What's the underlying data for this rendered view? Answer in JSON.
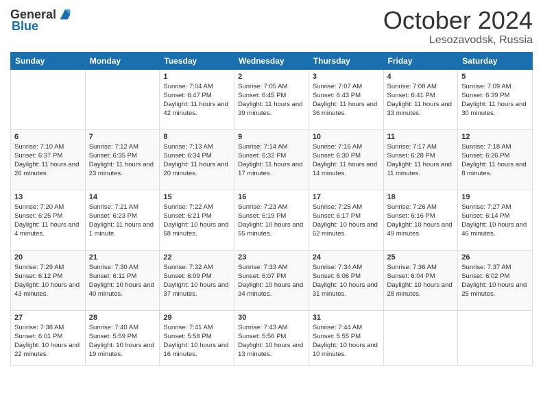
{
  "header": {
    "logo_general": "General",
    "logo_blue": "Blue",
    "month": "October 2024",
    "location": "Lesozavodsk, Russia"
  },
  "days_of_week": [
    "Sunday",
    "Monday",
    "Tuesday",
    "Wednesday",
    "Thursday",
    "Friday",
    "Saturday"
  ],
  "weeks": [
    [
      {
        "day": "",
        "info": ""
      },
      {
        "day": "",
        "info": ""
      },
      {
        "day": "1",
        "info": "Sunrise: 7:04 AM\nSunset: 6:47 PM\nDaylight: 11 hours and 42 minutes."
      },
      {
        "day": "2",
        "info": "Sunrise: 7:05 AM\nSunset: 6:45 PM\nDaylight: 11 hours and 39 minutes."
      },
      {
        "day": "3",
        "info": "Sunrise: 7:07 AM\nSunset: 6:43 PM\nDaylight: 11 hours and 36 minutes."
      },
      {
        "day": "4",
        "info": "Sunrise: 7:08 AM\nSunset: 6:41 PM\nDaylight: 11 hours and 33 minutes."
      },
      {
        "day": "5",
        "info": "Sunrise: 7:09 AM\nSunset: 6:39 PM\nDaylight: 11 hours and 30 minutes."
      }
    ],
    [
      {
        "day": "6",
        "info": "Sunrise: 7:10 AM\nSunset: 6:37 PM\nDaylight: 11 hours and 26 minutes."
      },
      {
        "day": "7",
        "info": "Sunrise: 7:12 AM\nSunset: 6:35 PM\nDaylight: 11 hours and 23 minutes."
      },
      {
        "day": "8",
        "info": "Sunrise: 7:13 AM\nSunset: 6:34 PM\nDaylight: 11 hours and 20 minutes."
      },
      {
        "day": "9",
        "info": "Sunrise: 7:14 AM\nSunset: 6:32 PM\nDaylight: 11 hours and 17 minutes."
      },
      {
        "day": "10",
        "info": "Sunrise: 7:16 AM\nSunset: 6:30 PM\nDaylight: 11 hours and 14 minutes."
      },
      {
        "day": "11",
        "info": "Sunrise: 7:17 AM\nSunset: 6:28 PM\nDaylight: 11 hours and 11 minutes."
      },
      {
        "day": "12",
        "info": "Sunrise: 7:18 AM\nSunset: 6:26 PM\nDaylight: 11 hours and 8 minutes."
      }
    ],
    [
      {
        "day": "13",
        "info": "Sunrise: 7:20 AM\nSunset: 6:25 PM\nDaylight: 11 hours and 4 minutes."
      },
      {
        "day": "14",
        "info": "Sunrise: 7:21 AM\nSunset: 6:23 PM\nDaylight: 11 hours and 1 minute."
      },
      {
        "day": "15",
        "info": "Sunrise: 7:22 AM\nSunset: 6:21 PM\nDaylight: 10 hours and 58 minutes."
      },
      {
        "day": "16",
        "info": "Sunrise: 7:23 AM\nSunset: 6:19 PM\nDaylight: 10 hours and 55 minutes."
      },
      {
        "day": "17",
        "info": "Sunrise: 7:25 AM\nSunset: 6:17 PM\nDaylight: 10 hours and 52 minutes."
      },
      {
        "day": "18",
        "info": "Sunrise: 7:26 AM\nSunset: 6:16 PM\nDaylight: 10 hours and 49 minutes."
      },
      {
        "day": "19",
        "info": "Sunrise: 7:27 AM\nSunset: 6:14 PM\nDaylight: 10 hours and 46 minutes."
      }
    ],
    [
      {
        "day": "20",
        "info": "Sunrise: 7:29 AM\nSunset: 6:12 PM\nDaylight: 10 hours and 43 minutes."
      },
      {
        "day": "21",
        "info": "Sunrise: 7:30 AM\nSunset: 6:11 PM\nDaylight: 10 hours and 40 minutes."
      },
      {
        "day": "22",
        "info": "Sunrise: 7:32 AM\nSunset: 6:09 PM\nDaylight: 10 hours and 37 minutes."
      },
      {
        "day": "23",
        "info": "Sunrise: 7:33 AM\nSunset: 6:07 PM\nDaylight: 10 hours and 34 minutes."
      },
      {
        "day": "24",
        "info": "Sunrise: 7:34 AM\nSunset: 6:06 PM\nDaylight: 10 hours and 31 minutes."
      },
      {
        "day": "25",
        "info": "Sunrise: 7:36 AM\nSunset: 6:04 PM\nDaylight: 10 hours and 28 minutes."
      },
      {
        "day": "26",
        "info": "Sunrise: 7:37 AM\nSunset: 6:02 PM\nDaylight: 10 hours and 25 minutes."
      }
    ],
    [
      {
        "day": "27",
        "info": "Sunrise: 7:38 AM\nSunset: 6:01 PM\nDaylight: 10 hours and 22 minutes."
      },
      {
        "day": "28",
        "info": "Sunrise: 7:40 AM\nSunset: 5:59 PM\nDaylight: 10 hours and 19 minutes."
      },
      {
        "day": "29",
        "info": "Sunrise: 7:41 AM\nSunset: 5:58 PM\nDaylight: 10 hours and 16 minutes."
      },
      {
        "day": "30",
        "info": "Sunrise: 7:43 AM\nSunset: 5:56 PM\nDaylight: 10 hours and 13 minutes."
      },
      {
        "day": "31",
        "info": "Sunrise: 7:44 AM\nSunset: 5:55 PM\nDaylight: 10 hours and 10 minutes."
      },
      {
        "day": "",
        "info": ""
      },
      {
        "day": "",
        "info": ""
      }
    ]
  ]
}
